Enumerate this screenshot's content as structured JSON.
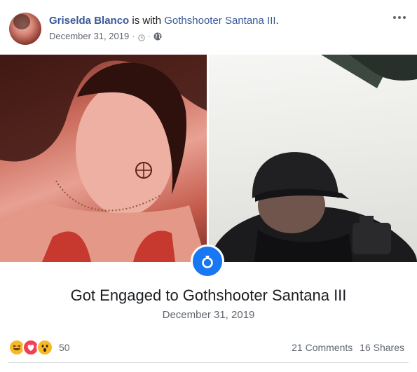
{
  "post": {
    "author": "Griselda Blanco",
    "with_text": "is with",
    "tagged": "Gothshooter Santana III",
    "period": ".",
    "timestamp": "December 31, 2019",
    "separator": "·"
  },
  "life_event": {
    "title": "Got Engaged to Gothshooter Santana III",
    "date": "December 31, 2019",
    "icon": "ring-icon"
  },
  "footer": {
    "reaction_count": "50",
    "comments": "21 Comments",
    "shares": "16 Shares"
  },
  "icons": {
    "privacy": [
      "clock-icon",
      "globe-icon"
    ],
    "reactions": [
      "haha-icon",
      "love-icon",
      "wow-icon"
    ],
    "more": "more-options-icon"
  },
  "colors": {
    "link": "#385898",
    "accent": "#1877f2",
    "meta_text": "#616770"
  }
}
